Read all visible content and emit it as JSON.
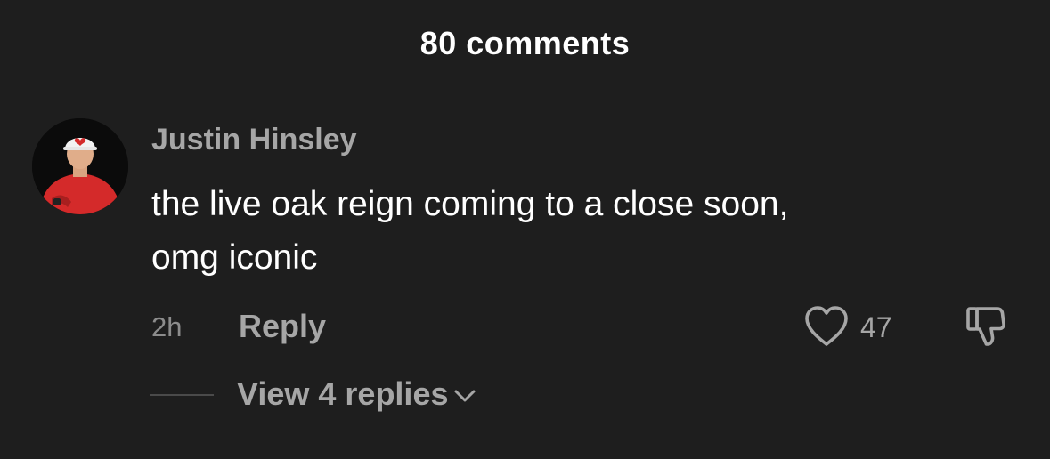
{
  "header": {
    "title": "80 comments"
  },
  "comment": {
    "author": "Justin Hinsley",
    "text_lines": [
      "the live oak reign coming to a close soon,",
      "omg iconic"
    ],
    "timestamp": "2h",
    "reply_label": "Reply",
    "like_count": "47",
    "view_replies_label": "View 4 replies"
  },
  "icons": {
    "like": "heart-outline-icon",
    "dislike": "thumbs-down-outline-icon",
    "expand": "chevron-down-icon"
  },
  "colors": {
    "background": "#1e1e1e",
    "primary_text": "#ffffff",
    "secondary_text": "#a6a6a6",
    "avatar_shirt": "#d42a2a"
  }
}
